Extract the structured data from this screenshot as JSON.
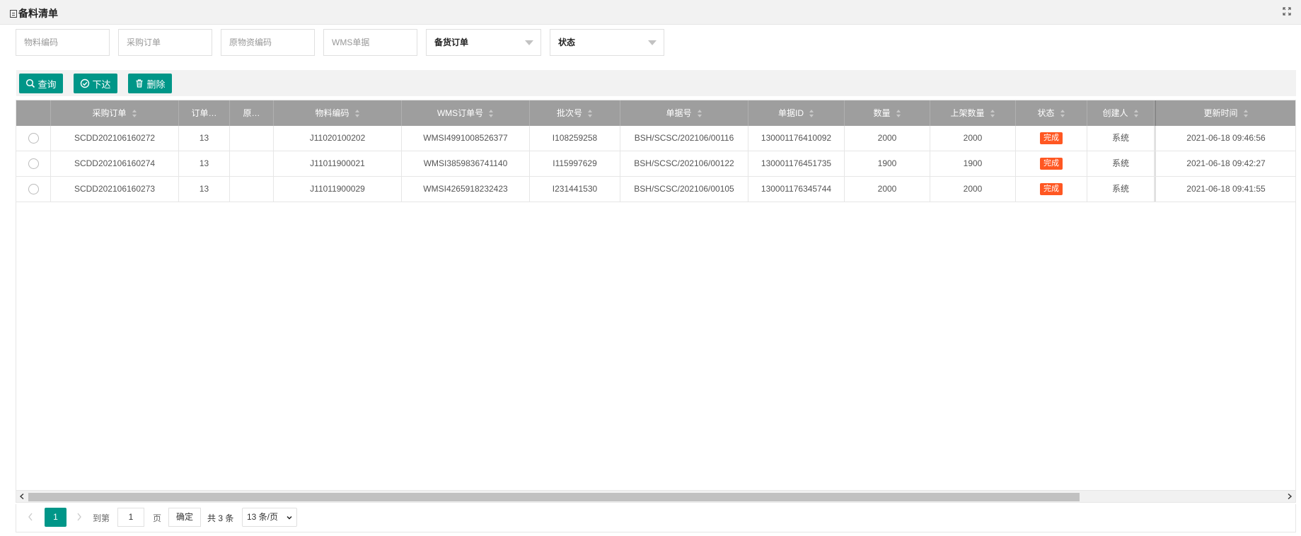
{
  "panel": {
    "title": "备料清单"
  },
  "filters": {
    "material_code_placeholder": "物料编码",
    "purchase_order_placeholder": "采购订单",
    "raw_material_code_placeholder": "原物资编码",
    "wms_doc_placeholder": "WMS单据",
    "order_type_value": "备货订单",
    "status_value": "状态"
  },
  "toolbar": {
    "query_label": "查询",
    "issue_label": "下达",
    "delete_label": "删除"
  },
  "table": {
    "headers": [
      "采购订单",
      "订单…",
      "原…",
      "物料编码",
      "WMS订单号",
      "批次号",
      "单据号",
      "单据ID",
      "数量",
      "上架数量",
      "状态",
      "创建人",
      "更新时间"
    ],
    "rows": [
      [
        "SCDD202106160272",
        "13",
        "",
        "J11020100202",
        "WMSI4991008526377",
        "I108259258",
        "BSH/SCSC/202106/00116",
        "130001176410092",
        "2000",
        "2000",
        "完成",
        "系统",
        "2021-06-18 09:46:56"
      ],
      [
        "SCDD202106160274",
        "13",
        "",
        "J11011900021",
        "WMSI3859836741140",
        "I115997629",
        "BSH/SCSC/202106/00122",
        "130001176451735",
        "1900",
        "1900",
        "完成",
        "系统",
        "2021-06-18 09:42:27"
      ],
      [
        "SCDD202106160273",
        "13",
        "",
        "J11011900029",
        "WMSI4265918232423",
        "I231441530",
        "BSH/SCSC/202106/00105",
        "130001176345744",
        "2000",
        "2000",
        "完成",
        "系统",
        "2021-06-18 09:41:55"
      ]
    ]
  },
  "pagination": {
    "current_page": "1",
    "goto_label": "到第",
    "goto_value": "1",
    "page_label": "页",
    "confirm_label": "确定",
    "total_text": "共 3 条",
    "page_size_value": "13 条/页"
  },
  "colors": {
    "accent": "#009688",
    "status_done": "#ff5722",
    "header_bg": "#9e9e9e"
  }
}
